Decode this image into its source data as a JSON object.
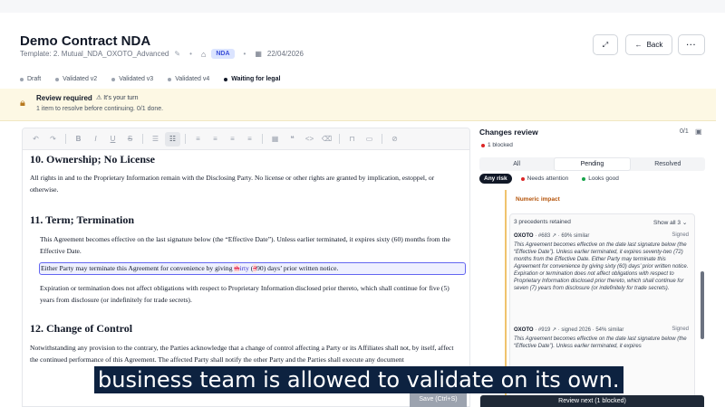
{
  "header": {
    "title": "Demo Contract NDA",
    "template": "Template: 2. Mutual_NDA_OXOTO_Advanced",
    "tag": "NDA",
    "date": "22/04/2026",
    "back_label": "Back"
  },
  "steps": [
    {
      "label": "Draft"
    },
    {
      "label": "Validated v2"
    },
    {
      "label": "Validated v3"
    },
    {
      "label": "Validated v4"
    },
    {
      "label": "Waiting for legal"
    }
  ],
  "review": {
    "title": "Review required",
    "turn": "It's your turn",
    "subtitle": "1 item to resolve before continuing. 0/1 done."
  },
  "document": {
    "s10_title": "10. Ownership; No License",
    "s10_text": "All rights in and to the Proprietary Information remain with the Disclosing Party. No license or other rights are granted by implication, estoppel, or otherwise.",
    "s11_title": "11. Term; Termination",
    "s11_p1": "This Agreement becomes effective on the last signature below (the “Effective Date”). Unless earlier terminated, it expires sixty (60) months from the Effective Date.",
    "hl_before": "Either Party may terminate this Agreement for convenience by giving ",
    "hl_del1": "th",
    "hl_ins1": "irty",
    "hl_mid": " (",
    "hl_del2": "3",
    "hl_ins2": "90) days’ prior written notice.",
    "s11_p2": "Expiration or termination does not affect obligations with respect to Proprietary Information disclosed prior thereto, which shall continue for five (5) years from disclosure (or indefinitely for trade secrets).",
    "s12_title": "12. Change of Control",
    "s12_text": "Notwithstanding any provision to the contrary, the Parties acknowledge that a change of control affecting a Party or its Affiliates shall not, by itself, affect the continued performance of this Agreement. The affected Party shall notify the other Party and the Parties shall execute any document",
    "save_label": "Save (Ctrl+S)"
  },
  "changes": {
    "title": "Changes review",
    "count": "0/1",
    "blocked": "1 blocked",
    "tabs": [
      "All",
      "Pending",
      "Resolved"
    ],
    "chips": [
      "Any risk",
      "Needs attention",
      "Looks good"
    ],
    "numeric_impact": "Numeric impact",
    "precedents_head": "3 precedents retained",
    "show_all": "Show all 3",
    "precedents": [
      {
        "source": "OXOTO",
        "ref": "#683",
        "similarity": "69% similar",
        "status": "Signed",
        "text": "This Agreement becomes effective on the date last signature below (the “Effective Date”). Unless earlier terminated, it expires seventy-two (72) months from the Effective Date. Either Party may terminate this Agreement for convenience by giving sixty (60) days’ prior written notice. Expiration or termination does not affect obligations with respect to Proprietary Information disclosed prior thereto, which shall continue for seven (7) years from disclosure (or indefinitely for trade secrets)."
      },
      {
        "source": "OXOTO",
        "ref": "#919",
        "similarity": "signed 2026 · 54% similar",
        "status": "Signed",
        "text": "This Agreement becomes effective on the date last signature below (the “Effective Date”). Unless earlier terminated, it expires"
      }
    ],
    "review_next": "Review next (1 blocked)"
  },
  "caption": "business team is allowed to validate on its own."
}
